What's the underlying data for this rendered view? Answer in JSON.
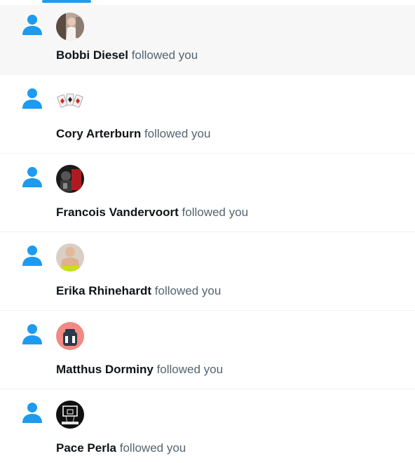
{
  "colors": {
    "accent": "#1d9bf0",
    "name_text": "#0f1419",
    "secondary_text": "#536471",
    "highlight_bg": "#f7f7f7",
    "divider": "#eff3f4"
  },
  "notifications": [
    {
      "name": "Bobbi Diesel",
      "action": "followed you",
      "icon": "person-icon",
      "highlighted": true
    },
    {
      "name": "Cory Arterburn",
      "action": "followed you",
      "icon": "person-icon",
      "highlighted": false
    },
    {
      "name": "Francois Vandervoort",
      "action": "followed you",
      "icon": "person-icon",
      "highlighted": false
    },
    {
      "name": "Erika Rhinehardt",
      "action": "followed you",
      "icon": "person-icon",
      "highlighted": false
    },
    {
      "name": "Matthus Dorminy",
      "action": "followed you",
      "icon": "person-icon",
      "highlighted": false
    },
    {
      "name": "Pace Perla",
      "action": "followed you",
      "icon": "person-icon",
      "highlighted": false
    }
  ]
}
